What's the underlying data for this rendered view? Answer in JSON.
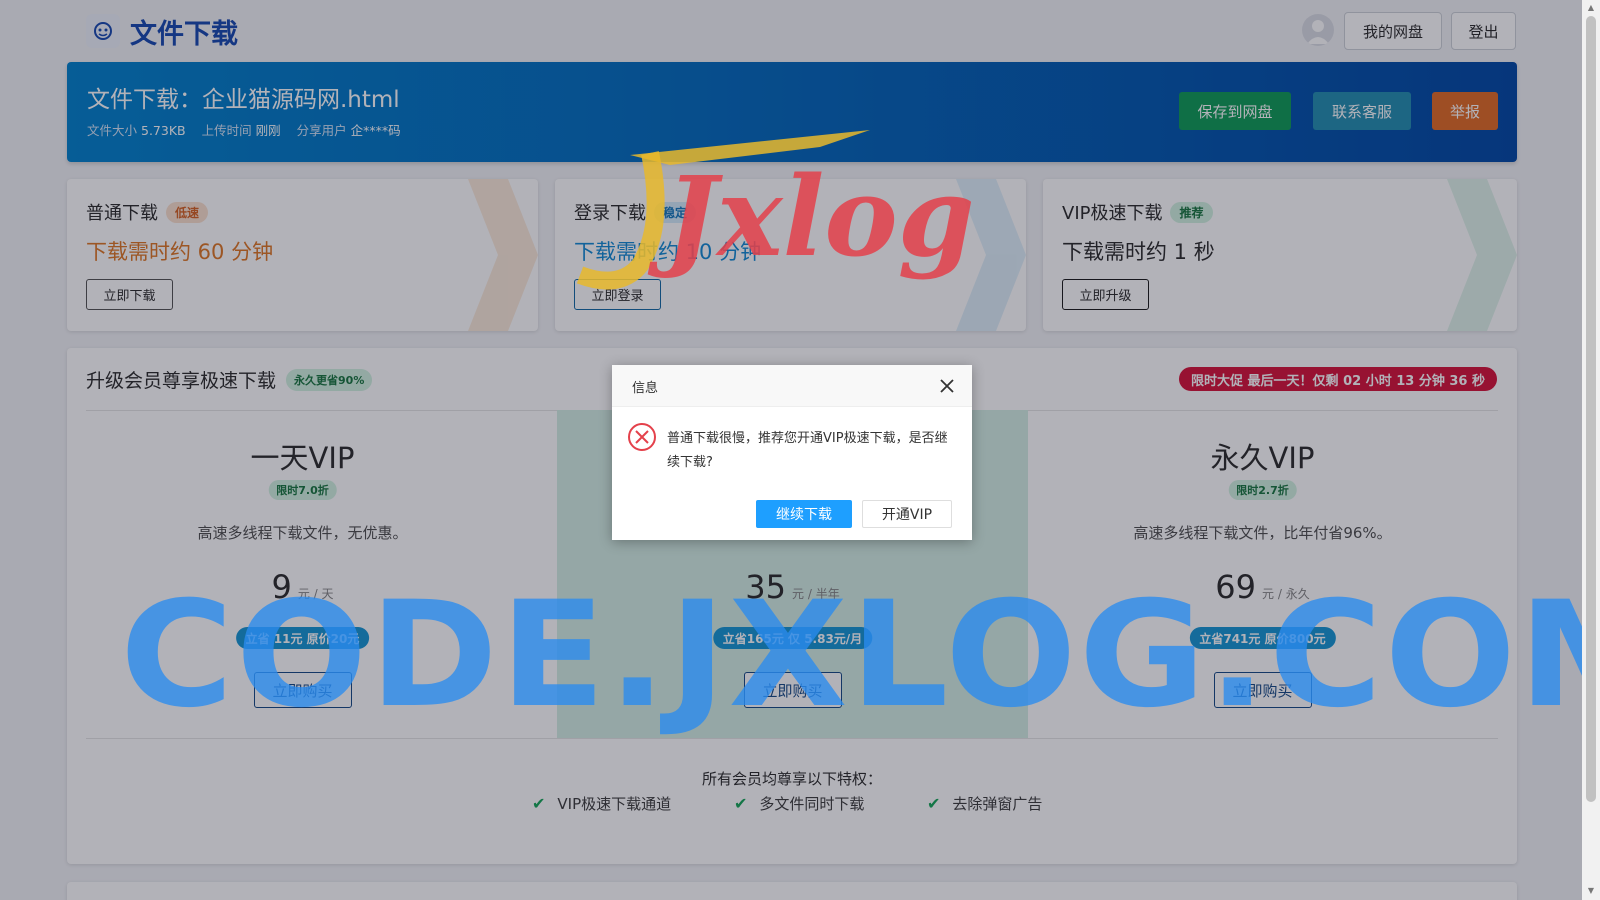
{
  "header": {
    "title": "文件下载",
    "my_disk_label": "我的网盘",
    "logout_label": "登出"
  },
  "file": {
    "title": "文件下载：企业猫源码网.html",
    "size_label": "文件大小",
    "size_value": "5.73KB",
    "upload_label": "上传时间",
    "upload_value": "刚刚",
    "share_label": "分享用户",
    "share_value": "企****码",
    "save_label": "保存到网盘",
    "contact_label": "联系客服",
    "report_label": "举报"
  },
  "cards": [
    {
      "title": "普通下载",
      "tag": "低速",
      "time": "下载需时约 60 分钟",
      "button": "立即下载"
    },
    {
      "title": "登录下载",
      "tag": "稳定",
      "time": "下载需时约 10 分钟",
      "button": "立即登录"
    },
    {
      "title": "VIP极速下载",
      "tag": "推荐",
      "time": "下载需时约 1 秒",
      "button": "立即升级"
    }
  ],
  "vip": {
    "heading": "升级会员尊享极速下载",
    "heading_tag": "永久更省90%",
    "promo": "限时大促 最后一天！仅剩 02 小时 13 分钟 36 秒",
    "plans": [
      {
        "name": "一天VIP",
        "discount": "限时7.0折",
        "desc": "高速多线程下载文件，无优惠。",
        "price": "9",
        "unit": "元 / 天",
        "save": "立省 11元 原价20元",
        "buy": "立即购买"
      },
      {
        "name": "",
        "discount": "",
        "desc": "",
        "price": "35",
        "unit": "元 / 半年",
        "save": "立省165元 仅 5.83元/月",
        "buy": "立即购买"
      },
      {
        "name": "永久VIP",
        "discount": "限时2.7折",
        "desc": "高速多线程下载文件，比年付省96%。",
        "price": "69",
        "unit": "元 / 永久",
        "save": "立省741元 原价800元",
        "buy": "立即购买"
      }
    ],
    "perks_title": "所有会员均尊享以下特权：",
    "perks": [
      "VIP极速下载通道",
      "多文件同时下载",
      "去除弹窗广告"
    ]
  },
  "dialog": {
    "title": "信息",
    "message": "普通下载很慢，推荐您开通VIP极速下载，是否继续下载?",
    "continue_label": "继续下载",
    "vip_label": "开通VIP"
  },
  "watermark": {
    "logo_text": "Jxlog",
    "url_text": "CODE.JXLOG.COM"
  },
  "colors": {
    "brand_blue": "#1f4fb4",
    "save_green": "#16a05c",
    "contact_teal": "#2a93b3",
    "report_orange": "#e2702b",
    "slow_orange": "#e07b2c",
    "login_blue": "#1a8fd6",
    "promo_red": "#d81b40",
    "dialog_primary": "#1e9fff"
  }
}
